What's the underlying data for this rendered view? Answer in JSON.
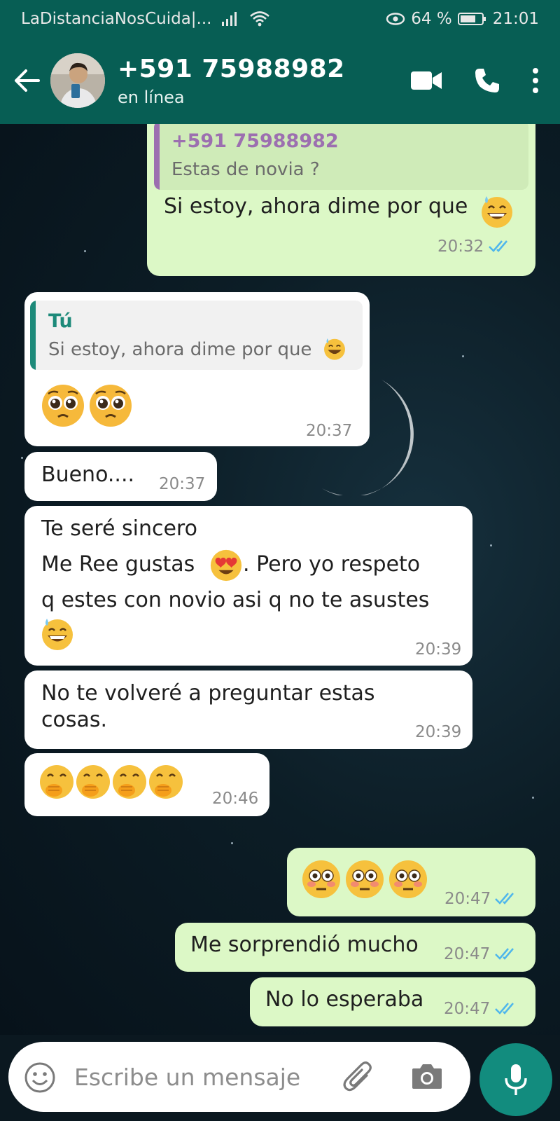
{
  "status_bar": {
    "carrier": "LaDistanciaNosCuida|...",
    "battery": "64 %",
    "time": "21:01",
    "icons": [
      "signal-icon",
      "wifi-icon",
      "eye-icon",
      "battery-icon"
    ]
  },
  "header": {
    "contact_name": "+591 75988982",
    "status": "en línea",
    "icons": [
      "back-arrow-icon",
      "video-call-icon",
      "phone-icon",
      "more-options-icon"
    ]
  },
  "messages": [
    {
      "direction": "out",
      "quote": {
        "name": "+591 75988982",
        "text": "Estas de novia ?"
      },
      "text": "Si estoy, ahora dime por que",
      "emoji": [
        "sweat-smile"
      ],
      "time": "20:32",
      "read": true
    },
    {
      "direction": "in",
      "quote": {
        "name": "Tú",
        "text": "Si estoy, ahora dime por que"
      },
      "emoji": [
        "pleading",
        "pleading"
      ],
      "time": "20:37"
    },
    {
      "direction": "in",
      "text": "Bueno....",
      "time": "20:37"
    },
    {
      "direction": "in",
      "lines": [
        "Te seré sincero",
        "Me Ree gustas",
        ". Pero yo respeto",
        "q estes con novio asi q no te asustes"
      ],
      "emoji": [
        "heart-eyes",
        "sweat-smile"
      ],
      "time": "20:39"
    },
    {
      "direction": "in",
      "lines": [
        "No te volveré a preguntar estas",
        "cosas."
      ],
      "time": "20:39"
    },
    {
      "direction": "in",
      "emoji": [
        "hand-over-mouth",
        "hand-over-mouth",
        "hand-over-mouth",
        "hand-over-mouth"
      ],
      "time": "20:46"
    },
    {
      "direction": "out",
      "emoji": [
        "flushed",
        "flushed",
        "flushed"
      ],
      "time": "20:47",
      "read": true
    },
    {
      "direction": "out",
      "text": "Me sorprendió mucho",
      "time": "20:47",
      "read": true
    },
    {
      "direction": "out",
      "text": "No lo esperaba",
      "time": "20:47",
      "read": true
    }
  ],
  "composer": {
    "placeholder": "Escribe un mensaje",
    "icons": [
      "emoji-icon",
      "attach-icon",
      "camera-icon",
      "mic-icon"
    ]
  },
  "colors": {
    "header": "#075e54",
    "outgoing_bubble": "#dcf8c6",
    "incoming_bubble": "#ffffff",
    "quote_contact": "#9c6fb0",
    "quote_self": "#1d8a7a",
    "read_ticks": "#4fb6ec",
    "mic_button": "#128c7e"
  }
}
